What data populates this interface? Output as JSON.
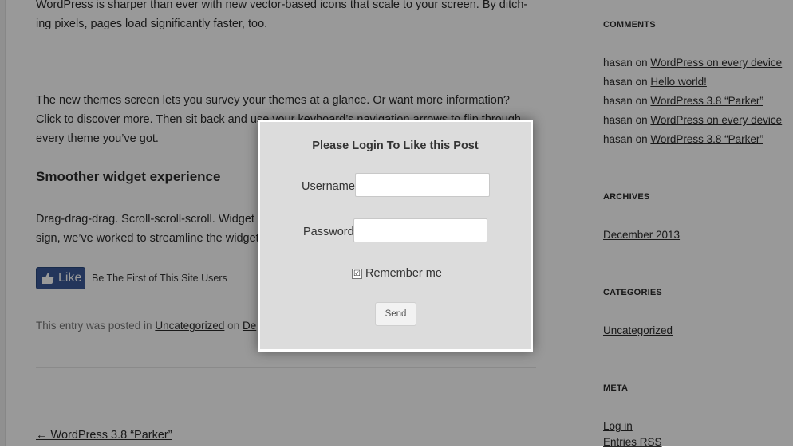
{
  "post": {
    "para1_line1": "WordPress is sharper than ever with new vector-based icons that scale to your screen. By ditch-",
    "para1_line2": "ing pixels, pages load significantly faster, too.",
    "para2_line1": "The new themes screen lets you survey your themes at a glance. Or want more information?",
    "para2_line2": "Click to discover more. Then sit back and use your keyboard’s navigation arrows to flip through",
    "para2_line3": "every theme you’ve got.",
    "heading": "Smoother widget experience",
    "para3_line1": "Drag-drag-drag. Scroll-scroll-scroll. Widget management can be complicated. With the new de-",
    "para3_line2": "sign, we’ve worked to streamline the widgets screen.",
    "like_button": "Like",
    "like_text": "Be The First of This Site Users",
    "posted_prefix": "This entry was posted in",
    "posted_category": "Uncategorized",
    "posted_on": "on",
    "posted_date": "De",
    "prev_post": "← WordPress 3.8 “Parker”"
  },
  "sidebar": {
    "comments_title": "COMMENTS",
    "comments": [
      {
        "author": "hasan",
        "on": "on",
        "post": "WordPress on every device"
      },
      {
        "author": "hasan",
        "on": "on",
        "post": "Hello world!"
      },
      {
        "author": "hasan",
        "on": "on",
        "post": "WordPress 3.8 “Parker”"
      },
      {
        "author": "hasan",
        "on": "on",
        "post": "WordPress on every device"
      },
      {
        "author": "hasan",
        "on": "on",
        "post": "WordPress 3.8 “Parker”"
      }
    ],
    "archives_title": "ARCHIVES",
    "archives": [
      "December 2013"
    ],
    "categories_title": "CATEGORIES",
    "categories": [
      "Uncategorized"
    ],
    "meta_title": "META",
    "meta": [
      "Log in",
      "Entries RSS"
    ]
  },
  "modal": {
    "title": "Please Login To Like this Post",
    "username_label": "Username",
    "username_value": "",
    "password_label": "Password",
    "password_value": "",
    "remember_label": "Remember me",
    "remember_checked": "☑",
    "send_label": "Send"
  },
  "colors": {
    "facebook_blue": "#3b5998",
    "overlay": "rgba(0,0,0,0.40)",
    "modal_bg": "#dcdcdc"
  }
}
